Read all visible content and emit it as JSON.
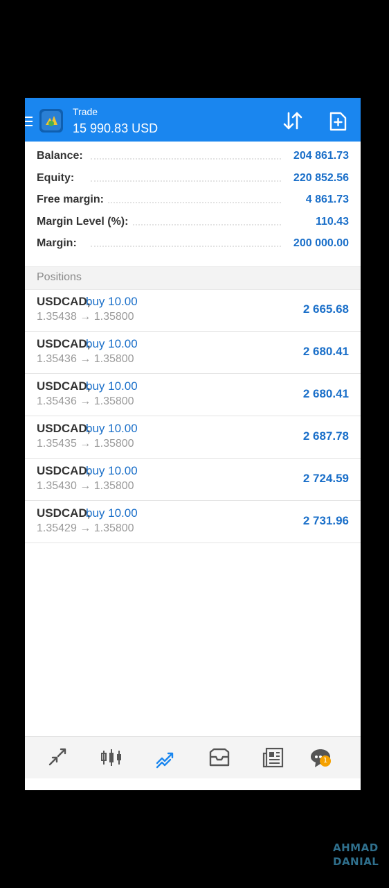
{
  "header": {
    "title": "Trade",
    "balance": "15 990.83 USD",
    "icons": [
      "menu-icon",
      "app-logo-icon",
      "sort-icon",
      "new-order-icon"
    ]
  },
  "summary": [
    {
      "label": "Balance:",
      "value": "204 861.73"
    },
    {
      "label": "Equity:",
      "value": "220 852.56"
    },
    {
      "label": "Free margin:",
      "value": "4 861.73"
    },
    {
      "label": "Margin Level (%):",
      "value": "110.43"
    },
    {
      "label": "Margin:",
      "value": "200 000.00"
    }
  ],
  "positions_header": "Positions",
  "positions": [
    {
      "symbol": "USDCAD,",
      "direction": "buy 10.00",
      "prices": "1.35438 → 1.35800",
      "profit": "2 665.68"
    },
    {
      "symbol": "USDCAD,",
      "direction": "buy 10.00",
      "prices": "1.35436 → 1.35800",
      "profit": "2 680.41"
    },
    {
      "symbol": "USDCAD,",
      "direction": "buy 10.00",
      "prices": "1.35436 → 1.35800",
      "profit": "2 680.41"
    },
    {
      "symbol": "USDCAD,",
      "direction": "buy 10.00",
      "prices": "1.35435 → 1.35800",
      "profit": "2 687.78"
    },
    {
      "symbol": "USDCAD,",
      "direction": "buy 10.00",
      "prices": "1.35430 → 1.35800",
      "profit": "2 724.59"
    },
    {
      "symbol": "USDCAD,",
      "direction": "buy 10.00",
      "prices": "1.35429 → 1.35800",
      "profit": "2 731.96"
    }
  ],
  "bottom_nav": {
    "items": [
      "quotes-icon",
      "chart-icon",
      "trade-icon",
      "history-icon",
      "news-icon",
      "chat-icon"
    ],
    "active": "trade-icon",
    "chat_badge": "1"
  },
  "watermark": {
    "line1": "AHMAD",
    "line2": "DANIAL"
  },
  "colors": {
    "primary": "#1a86ef",
    "value_blue": "#1a6fc9",
    "badge": "#f5a100"
  }
}
